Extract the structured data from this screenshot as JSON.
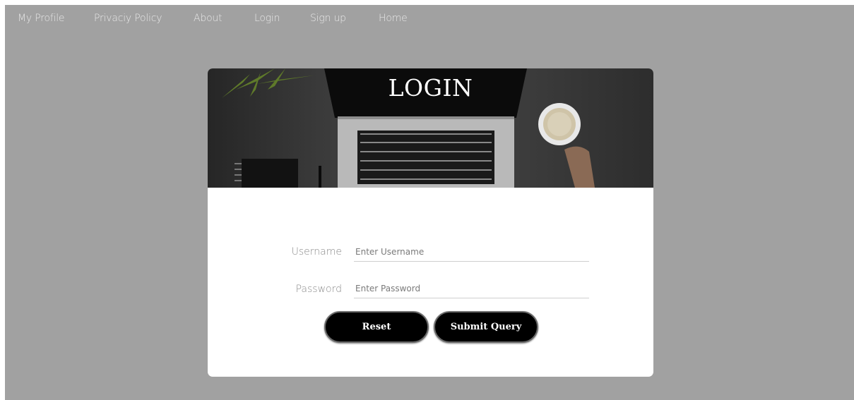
{
  "nav": {
    "items": [
      {
        "label": "My Profile"
      },
      {
        "label": "Privaciy Policy"
      },
      {
        "label": "About"
      },
      {
        "label": "Login"
      },
      {
        "label": "Sign up"
      },
      {
        "label": "Home"
      }
    ]
  },
  "login": {
    "title": "LOGIN",
    "username_label": "Username",
    "username_placeholder": "Enter Username",
    "password_label": "Password",
    "password_placeholder": "Enter Password",
    "reset_label": "Reset",
    "submit_label": "Submit Query"
  },
  "colors": {
    "page_background": "#a1a1a1",
    "card_background": "#ffffff",
    "button_background": "#000000",
    "button_text": "#ffffff"
  }
}
